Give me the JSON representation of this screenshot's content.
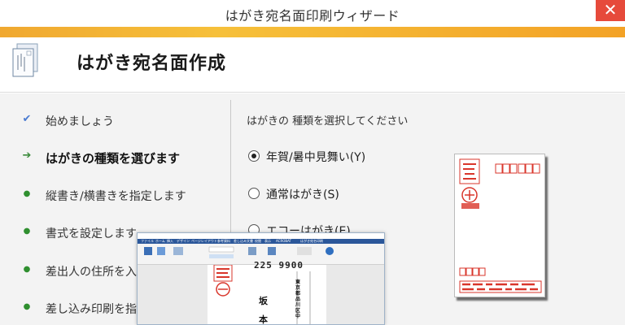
{
  "window": {
    "title": "はがき宛名面印刷ウィザード",
    "close_label": "✕"
  },
  "header": {
    "title": "はがき宛名面作成",
    "icon": "postcard-wizard-icon"
  },
  "steps": [
    {
      "label": "始めましょう",
      "state": "done",
      "marker": "✔"
    },
    {
      "label": "はがきの種類を選びます",
      "state": "current",
      "marker": "➔"
    },
    {
      "label": "縦書き/横書きを指定します",
      "state": "pending",
      "marker": "●"
    },
    {
      "label": "書式を設定します",
      "state": "pending",
      "marker": "●"
    },
    {
      "label": "差出人の住所を入",
      "state": "pending",
      "marker": "●"
    },
    {
      "label": "差し込み印刷を指",
      "state": "pending",
      "marker": "●"
    }
  ],
  "content": {
    "prompt": "はがきの 種類を選択してください",
    "options": [
      {
        "label": "年賀/暑中見舞い(Y)",
        "checked": true
      },
      {
        "label": "通常はがき(S)",
        "checked": false
      },
      {
        "label": "エコーはがき(E)",
        "checked": false
      }
    ]
  },
  "preview": {
    "type": "new-year-postcard",
    "accent_color": "#d9362b"
  },
  "overlay": {
    "tabs": [
      "ファイル",
      "ホーム",
      "挿入",
      "デザイン",
      "ページレイアウト",
      "参考資料",
      "差し込み文書",
      "校閲",
      "表示",
      "ACROBAT",
      "はがき宛名印刷"
    ],
    "zip_code": "225 9900",
    "name": [
      "坂",
      "本"
    ],
    "address": "東京都品川区中"
  },
  "colors": {
    "accent_start": "#f0a830",
    "accent_end": "#f3a226",
    "close": "#e64a3b",
    "ribbon": "#2b579a"
  }
}
